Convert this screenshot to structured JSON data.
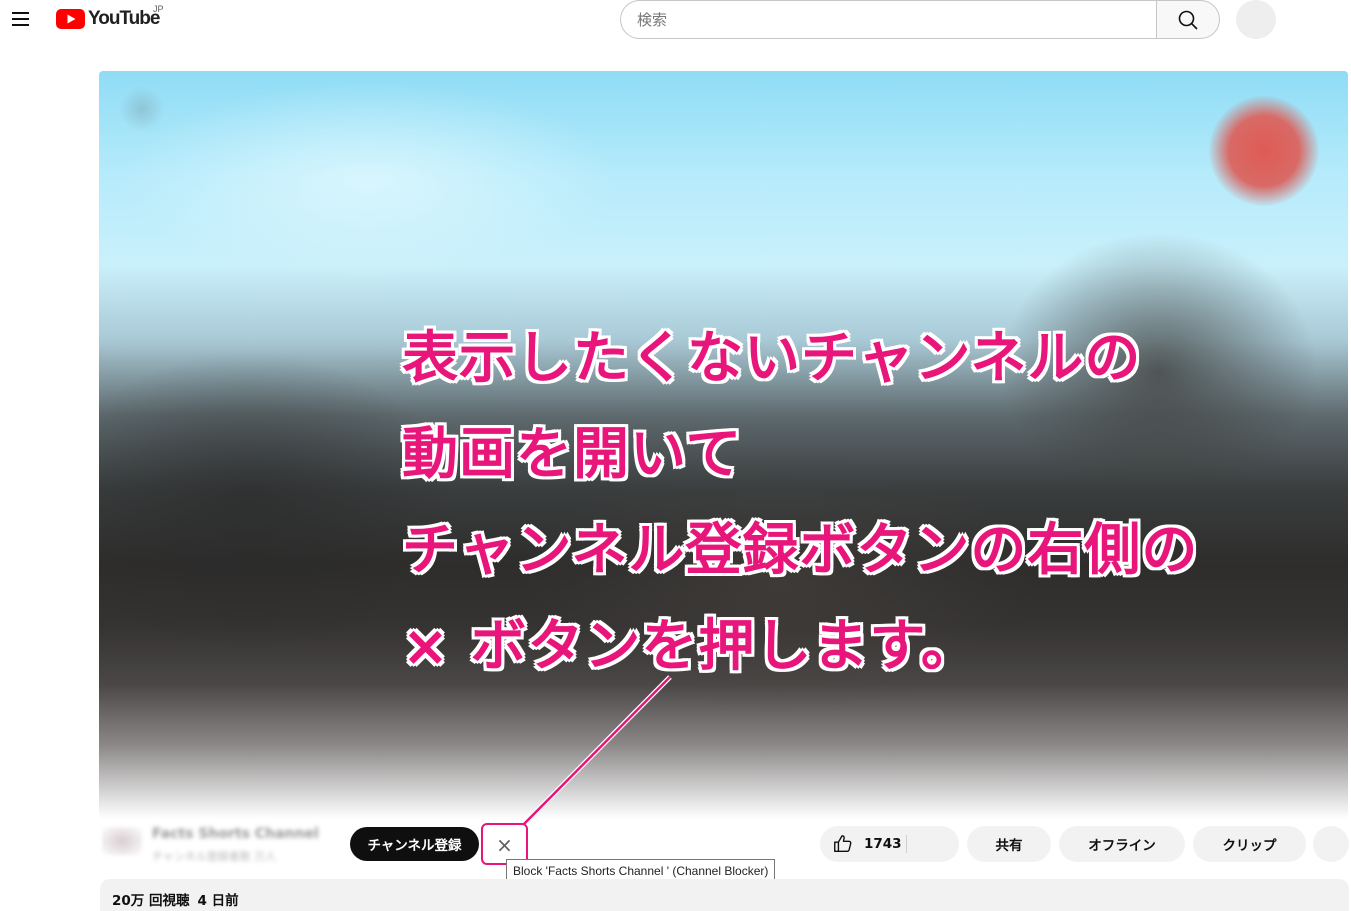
{
  "header": {
    "logo_text": "YouTube",
    "logo_country": "JP",
    "search_placeholder": "検索"
  },
  "annotation": {
    "lines": [
      "表示したくないチャンネルの",
      "動画を開いて",
      "チャンネル登録ボタンの右側の",
      "× ボタンを押します。"
    ],
    "color": "#e8157a"
  },
  "owner": {
    "name": "Facts Shorts Channel",
    "subs": "チャンネル登録者数 万人"
  },
  "actions": {
    "subscribe_label": "チャンネル登録",
    "block_label": "×",
    "tooltip": "Block 'Facts Shorts Channel ' (Channel Blocker)",
    "like_count": "1743",
    "share_label": "共有",
    "offline_label": "オフライン",
    "clip_label": "クリップ"
  },
  "description": {
    "views": "20万 回視聴",
    "date": "4 日前"
  },
  "colors": {
    "accent": "#e8157a",
    "brand_red": "#ff0000"
  }
}
